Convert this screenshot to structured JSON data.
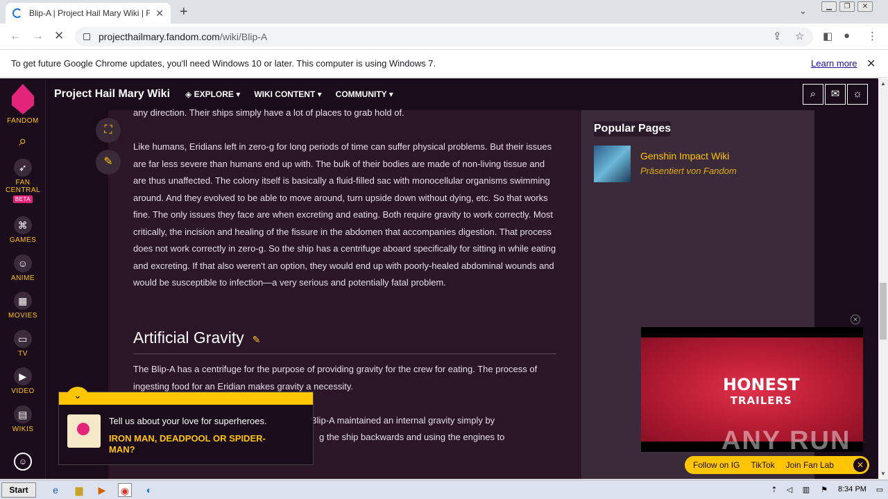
{
  "browser": {
    "tab_title": "Blip-A | Project Hail Mary Wiki | Fandom",
    "url_host": "projecthailmary.fandom.com",
    "url_path": "/wiki/Blip-A",
    "infobar_message": "To get future Google Chrome updates, you'll need Windows 10 or later. This computer is using Windows 7.",
    "infobar_link": "Learn more"
  },
  "rail": {
    "fandom": "FANDOM",
    "fan_central": "FAN CENTRAL",
    "beta": "BETA",
    "games": "GAMES",
    "anime": "ANIME",
    "movies": "MOVIES",
    "tv": "TV",
    "video": "VIDEO",
    "wikis": "WIKIS"
  },
  "wiki": {
    "name": "Project Hail Mary Wiki",
    "nav": [
      "EXPLORE",
      "WIKI CONTENT",
      "COMMUNITY"
    ]
  },
  "article": {
    "top_fragment": "any direction. Their ships simply have a lot of places to grab hold of.",
    "para1": "Like humans, Eridians left in zero-g for long periods of time can suffer physical problems. But their issues are far less severe than humans end up with. The bulk of their bodies are made of non-living tissue and are thus unaffected. The colony itself is basically a fluid-filled sac with monocellular organisms swimming around. And they evolved to be able to move around, turn upside down without dying, etc. So that works fine. The only issues they face are when excreting and eating. Both require gravity to work correctly. Most critically, the incision and healing of the fissure in the abdomen that accompanies digestion. That process does not work correctly in zero-g. So the ship has a centrifuge aboard specifically for sitting in while eating and excreting. If that also weren't an option, they would end up with poorly-healed abdominal wounds and would be susceptible to infection—a very serious and potentially fatal problem.",
    "heading": "Artificial Gravity",
    "para2": "The Blip-A has a centrifuge for the purpose of providing gravity for the crew for eating. The process of ingesting food for an Eridian makes gravity a necessity.",
    "behind1": "Blip-A maintained an internal gravity simply by",
    "behind2": "g the ship backwards and using the engines to"
  },
  "sidebar": {
    "popular_title": "Popular Pages",
    "item_name": "Genshin Impact Wiki",
    "item_sub": "Präsentiert von Fandom"
  },
  "video": {
    "title_line1": "HONEST",
    "title_line2": "TRAILERS",
    "follow_ig": "Follow on IG",
    "tiktok": "TikTok",
    "fan_lab": "Join Fan Lab"
  },
  "quiz": {
    "question": "Tell us about your love for superheroes.",
    "answer": "IRON MAN, DEADPOOL OR SPIDER-MAN?"
  },
  "watermark": "ANY RUN",
  "taskbar": {
    "start": "Start",
    "time": "8:34 PM"
  }
}
